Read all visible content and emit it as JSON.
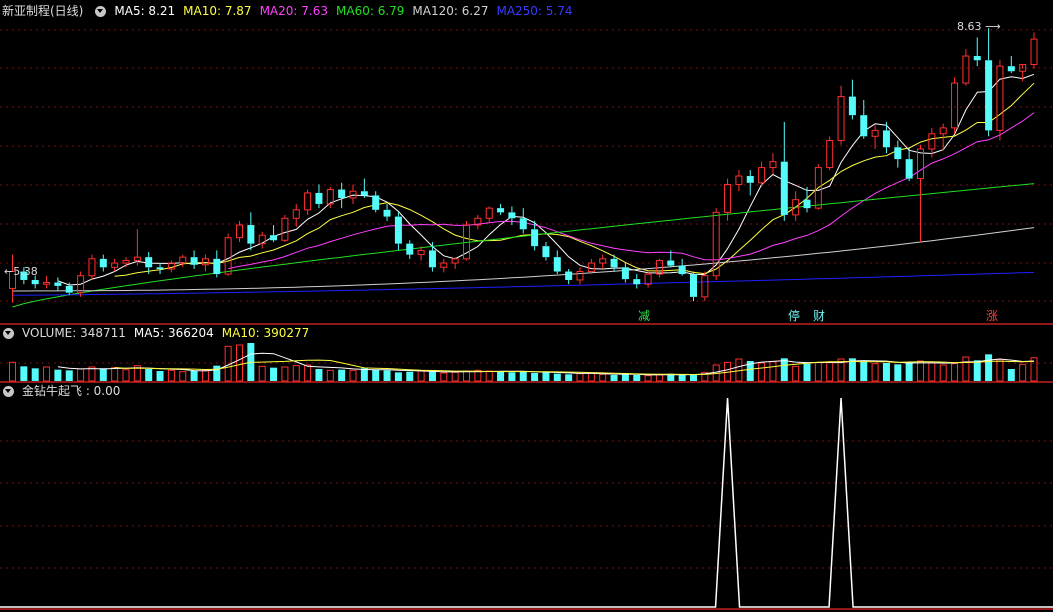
{
  "main_header": {
    "title": "新亚制程(日线)",
    "ma5": "MA5: 8.21",
    "ma10": "MA10: 7.87",
    "ma20": "MA20: 7.63",
    "ma60": "MA60: 6.79",
    "ma120": "MA120: 6.27",
    "ma250": "MA250: 5.74"
  },
  "volume_header": {
    "volume": "VOLUME: 348711",
    "ma5": "MA5: 366204",
    "ma10": "MA10: 390277"
  },
  "indicator_header": {
    "label": "金钻牛起飞 : 0.00"
  },
  "annotations": {
    "high": "8.63",
    "low": "5.38"
  },
  "markers": [
    {
      "text": "减",
      "color": "#2ee04a"
    },
    {
      "text": "停",
      "color": "#6ff0f0"
    },
    {
      "text": "财",
      "color": "#6ff0f0"
    },
    {
      "text": "涨",
      "color": "#ff4040"
    }
  ],
  "colors": {
    "up": "#ff3030",
    "down": "#54fcfc",
    "ma5": "#ffffff",
    "ma10": "#ffff40",
    "ma20": "#ff40ff",
    "ma60": "#20e020",
    "ma120": "#d0d0d0",
    "ma250": "#2020ff",
    "grid": "#7a1010",
    "separator": "#c02020"
  },
  "chart_data": {
    "type": "candlestick",
    "title": "新亚制程(日线)",
    "price_range": [
      5.2,
      8.75
    ],
    "candles": [
      [
        5.55,
        5.95,
        5.38,
        5.75
      ],
      [
        5.75,
        5.8,
        5.6,
        5.65
      ],
      [
        5.65,
        5.7,
        5.55,
        5.6
      ],
      [
        5.6,
        5.7,
        5.55,
        5.62
      ],
      [
        5.62,
        5.68,
        5.52,
        5.58
      ],
      [
        5.58,
        5.62,
        5.47,
        5.5
      ],
      [
        5.5,
        5.75,
        5.45,
        5.7
      ],
      [
        5.7,
        5.95,
        5.65,
        5.9
      ],
      [
        5.9,
        5.95,
        5.75,
        5.8
      ],
      [
        5.8,
        5.9,
        5.75,
        5.85
      ],
      [
        5.85,
        5.92,
        5.8,
        5.88
      ],
      [
        5.88,
        6.25,
        5.82,
        5.92
      ],
      [
        5.92,
        5.98,
        5.72,
        5.8
      ],
      [
        5.8,
        5.85,
        5.72,
        5.78
      ],
      [
        5.78,
        5.88,
        5.74,
        5.85
      ],
      [
        5.85,
        5.95,
        5.8,
        5.92
      ],
      [
        5.92,
        6.0,
        5.78,
        5.83
      ],
      [
        5.83,
        5.95,
        5.75,
        5.9
      ],
      [
        5.9,
        6.0,
        5.68,
        5.72
      ],
      [
        5.72,
        6.2,
        5.7,
        6.15
      ],
      [
        6.15,
        6.35,
        6.1,
        6.3
      ],
      [
        6.3,
        6.45,
        6.0,
        6.08
      ],
      [
        6.08,
        6.22,
        6.02,
        6.18
      ],
      [
        6.18,
        6.3,
        6.1,
        6.12
      ],
      [
        6.12,
        6.42,
        6.1,
        6.38
      ],
      [
        6.38,
        6.55,
        6.28,
        6.48
      ],
      [
        6.48,
        6.72,
        6.42,
        6.68
      ],
      [
        6.68,
        6.78,
        6.5,
        6.55
      ],
      [
        6.55,
        6.75,
        6.5,
        6.72
      ],
      [
        6.72,
        6.8,
        6.5,
        6.62
      ],
      [
        6.62,
        6.78,
        6.55,
        6.7
      ],
      [
        6.7,
        6.85,
        6.62,
        6.65
      ],
      [
        6.65,
        6.7,
        6.45,
        6.48
      ],
      [
        6.48,
        6.55,
        6.35,
        6.4
      ],
      [
        6.4,
        6.45,
        6.0,
        6.08
      ],
      [
        6.08,
        6.12,
        5.9,
        5.95
      ],
      [
        5.95,
        6.05,
        5.88,
        6.0
      ],
      [
        6.0,
        6.1,
        5.75,
        5.8
      ],
      [
        5.8,
        5.9,
        5.74,
        5.85
      ],
      [
        5.85,
        5.92,
        5.78,
        5.9
      ],
      [
        5.9,
        6.35,
        5.88,
        6.3
      ],
      [
        6.3,
        6.42,
        6.25,
        6.38
      ],
      [
        6.38,
        6.52,
        6.32,
        6.5
      ],
      [
        6.5,
        6.55,
        6.42,
        6.45
      ],
      [
        6.45,
        6.52,
        6.3,
        6.38
      ],
      [
        6.38,
        6.5,
        6.2,
        6.25
      ],
      [
        6.25,
        6.35,
        6.0,
        6.05
      ],
      [
        6.05,
        6.1,
        5.88,
        5.92
      ],
      [
        5.92,
        6.0,
        5.72,
        5.75
      ],
      [
        5.75,
        5.78,
        5.6,
        5.65
      ],
      [
        5.65,
        5.8,
        5.6,
        5.75
      ],
      [
        5.75,
        5.9,
        5.72,
        5.85
      ],
      [
        5.85,
        5.95,
        5.78,
        5.9
      ],
      [
        5.9,
        5.95,
        5.75,
        5.8
      ],
      [
        5.8,
        5.86,
        5.62,
        5.66
      ],
      [
        5.66,
        5.72,
        5.55,
        5.6
      ],
      [
        5.6,
        5.75,
        5.56,
        5.72
      ],
      [
        5.72,
        5.9,
        5.68,
        5.88
      ],
      [
        5.88,
        6.0,
        5.8,
        5.82
      ],
      [
        5.82,
        5.9,
        5.7,
        5.72
      ],
      [
        5.72,
        5.75,
        5.4,
        5.45
      ],
      [
        5.45,
        5.75,
        5.4,
        5.7
      ],
      [
        5.7,
        6.5,
        5.65,
        6.45
      ],
      [
        6.45,
        6.85,
        6.35,
        6.78
      ],
      [
        6.78,
        6.95,
        6.7,
        6.88
      ],
      [
        6.88,
        6.95,
        6.65,
        6.8
      ],
      [
        6.8,
        7.05,
        6.75,
        6.98
      ],
      [
        6.98,
        7.15,
        6.9,
        7.05
      ],
      [
        7.05,
        7.52,
        6.35,
        6.42
      ],
      [
        6.42,
        6.7,
        6.35,
        6.6
      ],
      [
        6.6,
        6.75,
        6.45,
        6.5
      ],
      [
        6.5,
        7.02,
        6.48,
        6.98
      ],
      [
        6.98,
        7.35,
        6.95,
        7.3
      ],
      [
        7.3,
        7.95,
        7.25,
        7.82
      ],
      [
        7.82,
        8.02,
        7.55,
        7.6
      ],
      [
        7.6,
        7.78,
        7.32,
        7.35
      ],
      [
        7.35,
        7.48,
        7.2,
        7.42
      ],
      [
        7.42,
        7.52,
        7.15,
        7.22
      ],
      [
        7.22,
        7.3,
        6.98,
        7.08
      ],
      [
        7.08,
        7.22,
        6.82,
        6.85
      ],
      [
        6.85,
        7.25,
        6.1,
        7.2
      ],
      [
        7.2,
        7.45,
        7.1,
        7.38
      ],
      [
        7.38,
        7.5,
        7.18,
        7.45
      ],
      [
        7.45,
        8.05,
        7.38,
        7.98
      ],
      [
        7.98,
        8.38,
        7.95,
        8.3
      ],
      [
        8.3,
        8.52,
        8.18,
        8.25
      ],
      [
        8.25,
        8.63,
        7.35,
        7.42
      ],
      [
        7.42,
        8.25,
        7.3,
        8.18
      ],
      [
        8.18,
        8.3,
        8.1,
        8.12
      ],
      [
        8.12,
        8.15,
        8.0,
        8.2
      ],
      [
        8.2,
        8.58,
        8.15,
        8.5
      ]
    ],
    "volumes": [
      280000,
      220000,
      190000,
      210000,
      170000,
      160000,
      180000,
      210000,
      190000,
      200000,
      170000,
      230000,
      180000,
      150000,
      160000,
      140000,
      150000,
      160000,
      230000,
      520000,
      540000,
      570000,
      220000,
      200000,
      210000,
      230000,
      240000,
      180000,
      160000,
      170000,
      160000,
      190000,
      170000,
      160000,
      130000,
      140000,
      150000,
      140000,
      120000,
      130000,
      150000,
      160000,
      150000,
      140000,
      130000,
      150000,
      120000,
      130000,
      110000,
      100000,
      110000,
      120000,
      100000,
      90000,
      100000,
      90000,
      80000,
      100000,
      110000,
      90000,
      100000,
      130000,
      240000,
      280000,
      330000,
      300000,
      270000,
      290000,
      340000,
      220000,
      260000,
      280000,
      290000,
      330000,
      340000,
      290000,
      260000,
      270000,
      250000,
      280000,
      300000,
      270000,
      240000,
      260000,
      360000,
      310000,
      400000,
      320000,
      180000,
      250000,
      348711
    ],
    "indicator": {
      "name": "金钻牛起飞",
      "value": 0.0,
      "signals_at_index": [
        63,
        73
      ]
    }
  }
}
